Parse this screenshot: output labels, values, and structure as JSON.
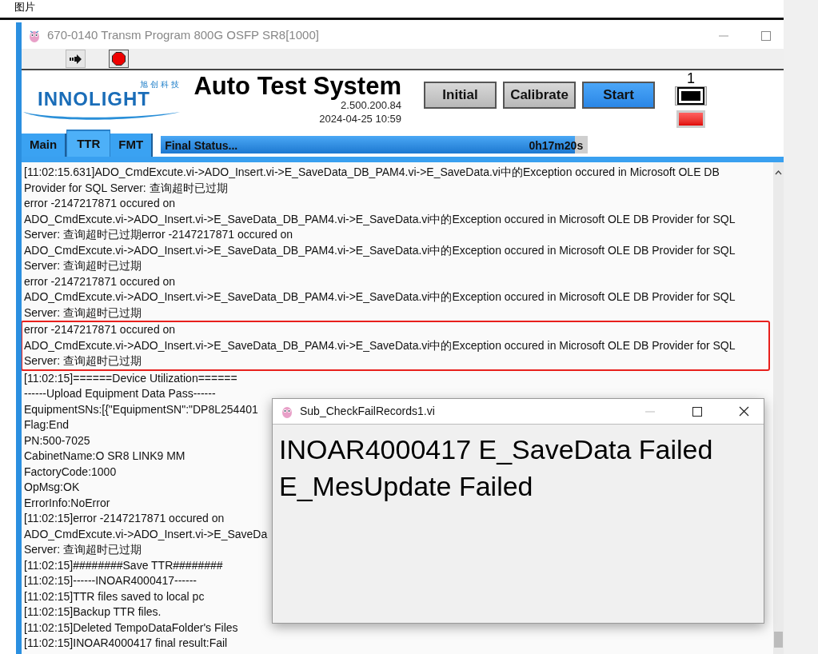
{
  "outer_window": {
    "title": "图片"
  },
  "window": {
    "title": "670-0140 Transm Program 800G OSFP SR8[1000]"
  },
  "header": {
    "logo_cn": "旭创科技",
    "logo_en": "INNOLIGHT",
    "app_title": "Auto Test System",
    "version": "2.500.200.84",
    "datetime": "2024-04-25 10:59"
  },
  "buttons": [
    {
      "label": "Initial",
      "kind": "gray"
    },
    {
      "label": "Calibrate",
      "kind": "gray"
    },
    {
      "label": "Start",
      "kind": "blue"
    }
  ],
  "indicator": {
    "label": "1",
    "led_on": true
  },
  "tabs": [
    {
      "label": "Main",
      "selected": false
    },
    {
      "label": "TTR",
      "selected": true
    },
    {
      "label": "FMT",
      "selected": false
    }
  ],
  "status": {
    "label": "Final Status...",
    "elapsed": "0h17m20s",
    "level": 0.97
  },
  "log": {
    "groups": [
      {
        "highlighted": false,
        "lines": [
          "[11:02:15.631]ADO_CmdExcute.vi->ADO_Insert.vi->E_SaveData_DB_PAM4.vi->E_SaveData.vi中的Exception occured in Microsoft OLE DB",
          "Provider for SQL Server: 查询超时已过期",
          "error -2147217871 occured on",
          "ADO_CmdExcute.vi->ADO_Insert.vi->E_SaveData_DB_PAM4.vi->E_SaveData.vi中的Exception occured in Microsoft OLE DB Provider for SQL",
          "Server: 查询超时已过期error -2147217871 occured on",
          "ADO_CmdExcute.vi->ADO_Insert.vi->E_SaveData_DB_PAM4.vi->E_SaveData.vi中的Exception occured in Microsoft OLE DB Provider for SQL",
          "Server: 查询超时已过期",
          "error -2147217871 occured on",
          "ADO_CmdExcute.vi->ADO_Insert.vi->E_SaveData_DB_PAM4.vi->E_SaveData.vi中的Exception occured in Microsoft OLE DB Provider for SQL",
          "Server: 查询超时已过期"
        ]
      },
      {
        "highlighted": true,
        "lines": [
          "error -2147217871 occured on",
          "ADO_CmdExcute.vi->ADO_Insert.vi->E_SaveData_DB_PAM4.vi->E_SaveData.vi中的Exception occured in Microsoft OLE DB Provider for SQL",
          "Server: 查询超时已过期"
        ]
      },
      {
        "highlighted": false,
        "lines": [
          "[11:02:15]======Device Utilization======",
          "------Upload Equipment Data Pass------",
          "EquipmentSNs:[{\"EquipmentSN\":\"DP8L254401",
          "Flag:End",
          "PN:500-7025",
          "CabinetName:O SR8 LINK9 MM",
          "FactoryCode:1000",
          "OpMsg:OK",
          "ErrorInfo:NoError",
          "[11:02:15]error -2147217871 occured on",
          "ADO_CmdExcute.vi->ADO_Insert.vi->E_SaveDa",
          "Server: 查询超时已过期",
          "[11:02:15]########Save TTR########",
          "[11:02:15]------INOAR4000417------",
          "[11:02:15]TTR files saved to local pc",
          "[11:02:15]Backup TTR files.",
          "[11:02:15]Deleted TempoDataFolder's Files",
          "[11:02:15]INOAR4000417 final result:Fail"
        ]
      }
    ]
  },
  "dialog": {
    "title": "Sub_CheckFailRecords1.vi",
    "message_lines": [
      "INOAR4000417 E_SaveData Failed",
      "E_MesUpdate Failed"
    ]
  }
}
